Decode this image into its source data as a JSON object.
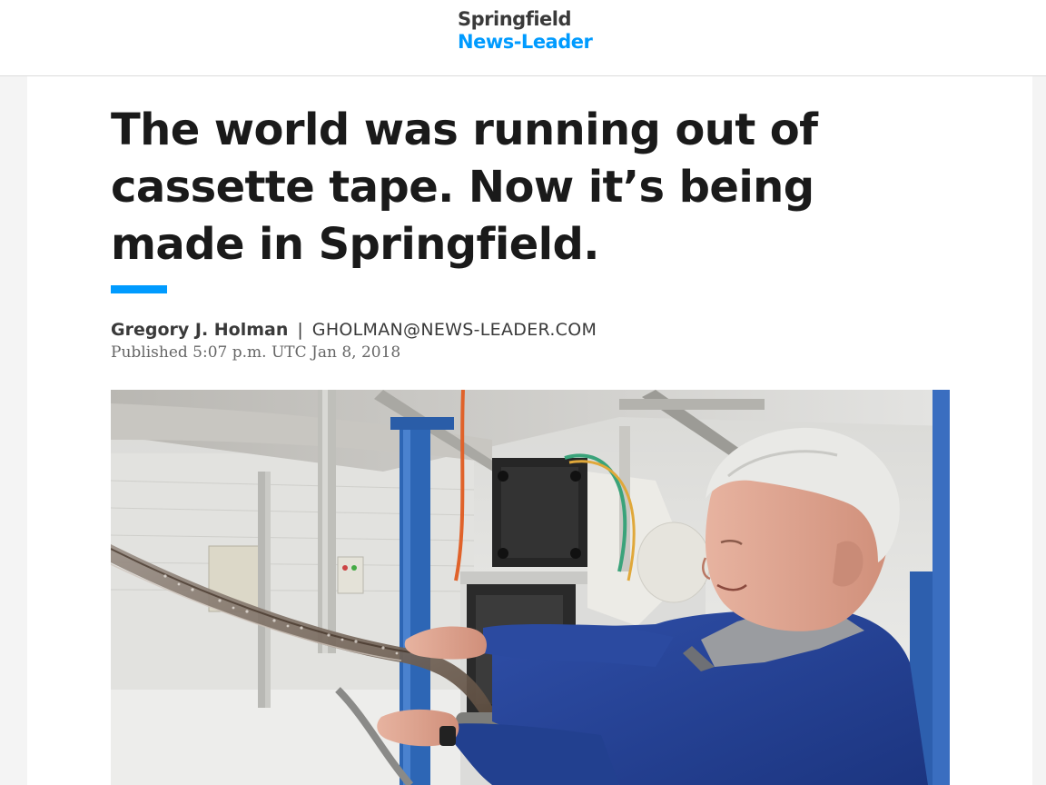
{
  "masthead": {
    "logo_line1": "Springfield",
    "logo_line2": "News-Leader"
  },
  "article": {
    "headline": "The world was running out of cassette tape. Now it’s being made in Springfield.",
    "author": "Gregory J. Holman",
    "separator": "|",
    "email": "GHOLMAN@NEWS-LEADER.COM",
    "published": "Published 5:07 p.m. UTC Jan 8, 2018"
  },
  "colors": {
    "accent": "#009bff",
    "headline": "#1a1a1a",
    "byline": "#3a3a3a",
    "meta": "#666666"
  }
}
